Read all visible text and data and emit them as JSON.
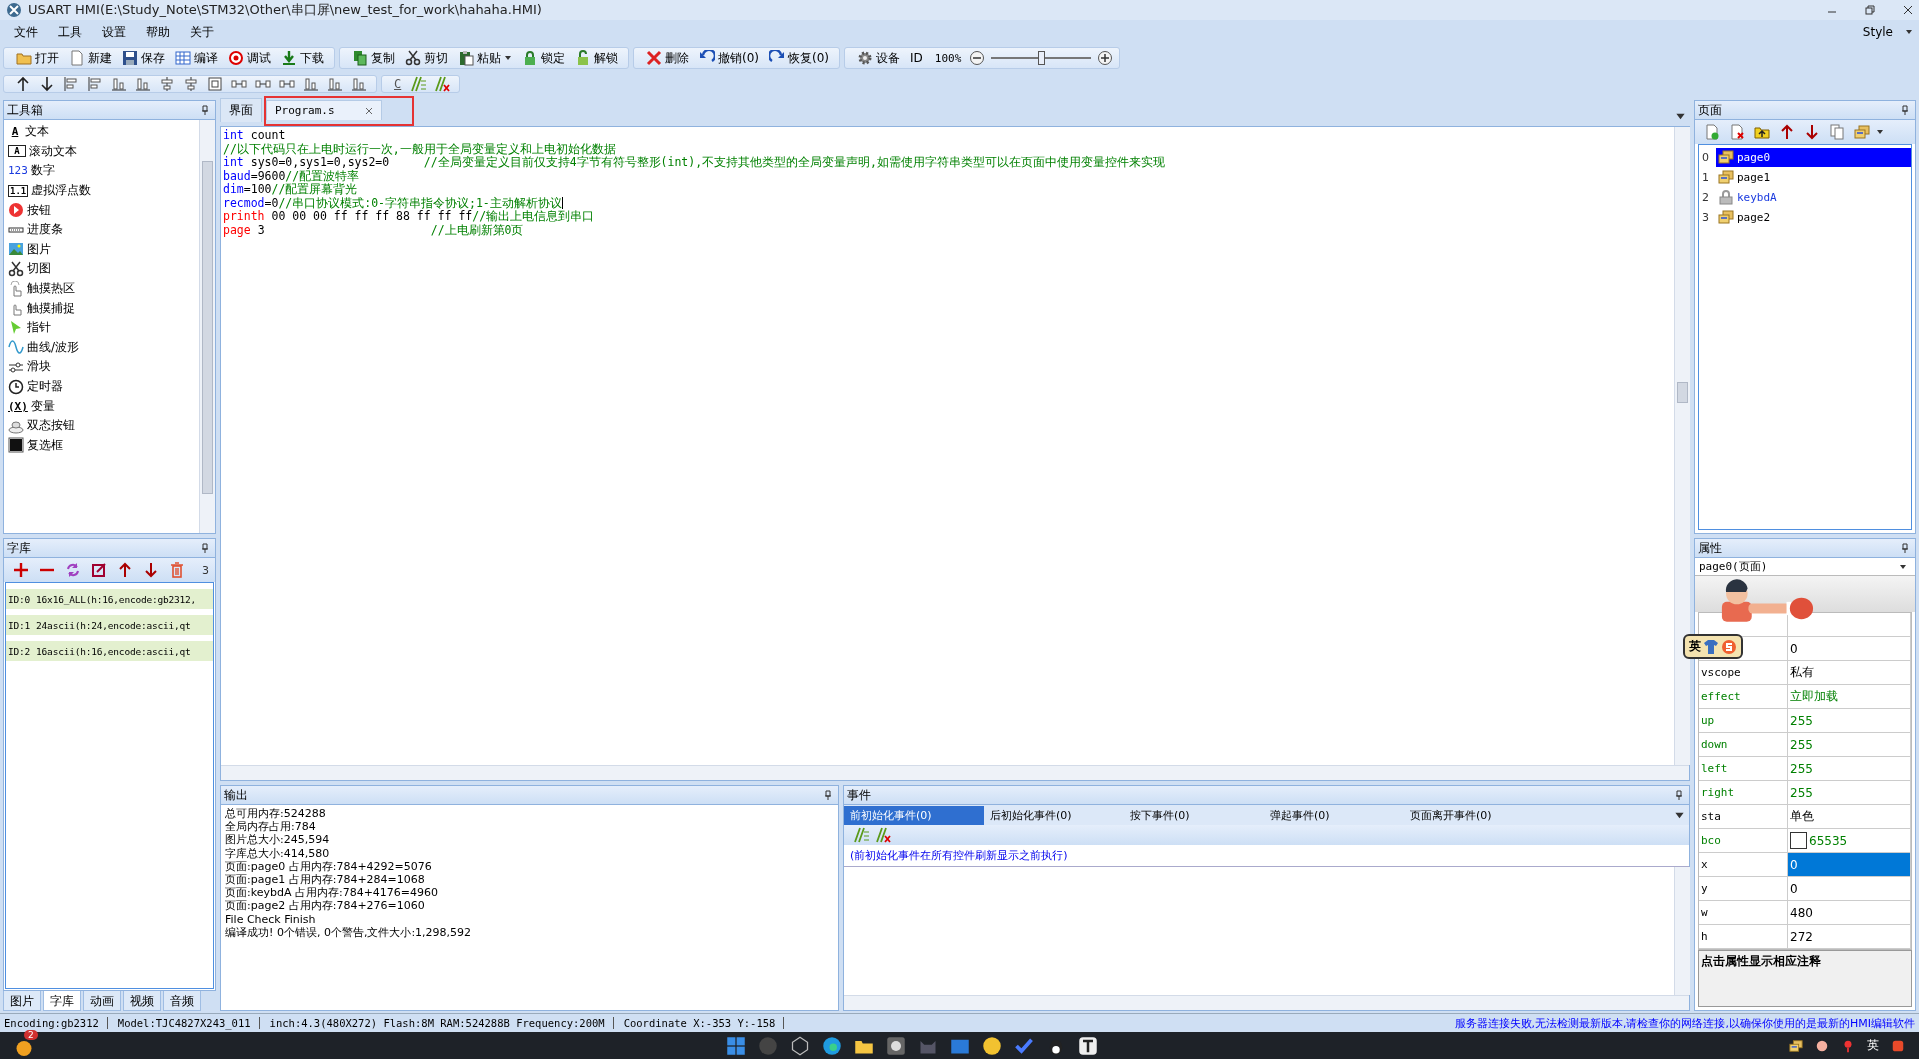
{
  "window": {
    "title": "USART  HMI(E:\\Study_Note\\STM32\\Other\\串口屏\\new_test_for_work\\hahaha.HMI)",
    "style_menu": "Style"
  },
  "menu": [
    "文件",
    "工具",
    "设置",
    "帮助",
    "关于"
  ],
  "toolbar": {
    "groups": [
      [
        "打开",
        "新建",
        "保存",
        "编译",
        "调试",
        "下载"
      ],
      [
        "复制",
        "剪切",
        "粘贴",
        "锁定",
        "解锁"
      ],
      [
        "删除",
        "撤销(0)",
        "恢复(0)"
      ]
    ],
    "device": "设备",
    "id_button": "ID",
    "zoom": {
      "reading": "100%",
      "level": 0.5
    }
  },
  "align_toolbar": {
    "code_button": "C"
  },
  "toolbox": {
    "title": "工具箱",
    "items": [
      {
        "label": "文本",
        "glyph": "A"
      },
      {
        "label": "滚动文本",
        "glyph": "A",
        "boxed": true
      },
      {
        "label": "数字",
        "glyph": "123"
      },
      {
        "label": "虚拟浮点数",
        "glyph": "1.1",
        "boxed": true
      },
      {
        "label": "按钮"
      },
      {
        "label": "进度条"
      },
      {
        "label": "图片"
      },
      {
        "label": "切图"
      },
      {
        "label": "触摸热区"
      },
      {
        "label": "触摸捕捉"
      },
      {
        "label": "指针"
      },
      {
        "label": "曲线/波形"
      },
      {
        "label": "滑块"
      },
      {
        "label": "定时器"
      },
      {
        "label": "变量",
        "glyph": "(X)"
      },
      {
        "label": "双态按钮"
      },
      {
        "label": "复选框"
      }
    ]
  },
  "font_library": {
    "title": "字库",
    "count": "3",
    "items": [
      {
        "id": "ID:0",
        "name": "16x16_ALL(h:16,encode:gb2312,"
      },
      {
        "id": "ID:1",
        "name": "24ascii(h:24,encode:ascii,qt"
      },
      {
        "id": "ID:2",
        "name": "16ascii(h:16,encode:ascii,qt"
      }
    ]
  },
  "left_tabs": [
    {
      "label": "图片",
      "selected": false
    },
    {
      "label": "字库",
      "selected": true
    },
    {
      "label": "动画",
      "selected": false
    },
    {
      "label": "视频",
      "selected": false
    },
    {
      "label": "音频",
      "selected": false
    }
  ],
  "editor_tabs": [
    {
      "label": "界面",
      "selected": false
    },
    {
      "label": "Program.s",
      "selected": true,
      "closable": true,
      "highlighted": true
    }
  ],
  "code": [
    {
      "segments": [
        {
          "text": "int",
          "kind": "keyword"
        },
        {
          "text": " count",
          "kind": "plain"
        }
      ]
    },
    {
      "segments": [
        {
          "text": "//以下代码只在上电时运行一次,一般用于全局变量定义和上电初始化数据",
          "kind": "comment"
        }
      ]
    },
    {
      "segments": [
        {
          "text": "int",
          "kind": "keyword"
        },
        {
          "text": " sys0=0,sys1=0,sys2=0     ",
          "kind": "plain"
        },
        {
          "text": "//全局变量定义目前仅支持4字节有符号整形(int),不支持其他类型的全局变量声明,如需使用字符串类型可以在页面中使用变量控件来实现",
          "kind": "comment"
        }
      ]
    },
    {
      "segments": [
        {
          "text": "baud",
          "kind": "keyword"
        },
        {
          "text": "=9600",
          "kind": "plain"
        },
        {
          "text": "//配置波特率",
          "kind": "comment"
        }
      ]
    },
    {
      "segments": [
        {
          "text": "dim",
          "kind": "keyword"
        },
        {
          "text": "=100",
          "kind": "plain"
        },
        {
          "text": "//配置屏幕背光",
          "kind": "comment"
        }
      ]
    },
    {
      "segments": [
        {
          "text": "recmod",
          "kind": "keyword"
        },
        {
          "text": "=0",
          "kind": "plain"
        },
        {
          "text": "//串口协议模式:0-字符串指令协议;1-主动解析协议",
          "kind": "comment"
        }
      ],
      "cursor": true
    },
    {
      "segments": [
        {
          "text": "printh",
          "kind": "command"
        },
        {
          "text": " 00 00 00 ff ff ff 88 ff ff ff",
          "kind": "plain"
        },
        {
          "text": "//输出上电信息到串口",
          "kind": "comment"
        }
      ]
    },
    {
      "segments": [
        {
          "text": "page",
          "kind": "command"
        },
        {
          "text": " 3                        ",
          "kind": "plain"
        },
        {
          "text": "//上电刷新第0页",
          "kind": "comment"
        }
      ]
    }
  ],
  "output": {
    "title": "输出",
    "lines": [
      "总可用内存:524288",
      "全局内存占用:784",
      "图片总大小:245,594",
      "字库总大小:414,580",
      "页面:page0 占用内存:784+4292=5076",
      "页面:page1 占用内存:784+284=1068",
      "页面:keybdA 占用内存:784+4176=4960",
      "页面:page2 占用内存:784+276=1060",
      "File Check Finish",
      "编译成功! 0个错误, 0个警告,文件大小:1,298,592"
    ]
  },
  "events": {
    "title": "事件",
    "tabs": [
      {
        "label": "前初始化事件(0)",
        "selected": true
      },
      {
        "label": "后初始化事件(0)",
        "selected": false
      },
      {
        "label": "按下事件(0)",
        "selected": false
      },
      {
        "label": "弹起事件(0)",
        "selected": false
      },
      {
        "label": "页面离开事件(0)",
        "selected": false
      }
    ],
    "note": "(前初始化事件在所有控件刷新显示之前执行)"
  },
  "pages": {
    "title": "页面",
    "items": [
      {
        "index": "0",
        "name": "page0",
        "selected": true,
        "locked": false
      },
      {
        "index": "1",
        "name": "page1",
        "selected": false,
        "locked": false
      },
      {
        "index": "2",
        "name": "keybdA",
        "selected": false,
        "locked": true
      },
      {
        "index": "3",
        "name": "page2",
        "selected": false,
        "locked": false
      }
    ]
  },
  "properties": {
    "title": "属性",
    "object": "page0(页面)",
    "rows": [
      {
        "value": "0",
        "runtime_editable": false,
        "selected": false
      },
      {
        "name": "vscope",
        "value": "私有",
        "runtime_editable": false,
        "selected": false
      },
      {
        "name": "effect",
        "value": "立即加载",
        "runtime_editable": true,
        "selected": false
      },
      {
        "name": "up",
        "value": "255",
        "runtime_editable": true,
        "selected": false
      },
      {
        "name": "down",
        "value": "255",
        "runtime_editable": true,
        "selected": false
      },
      {
        "name": "left",
        "value": "255",
        "runtime_editable": true,
        "selected": false
      },
      {
        "name": "right",
        "value": "255",
        "runtime_editable": true,
        "selected": false
      },
      {
        "name": "sta",
        "value": "单色",
        "runtime_editable": false,
        "selected": false
      },
      {
        "name": "bco",
        "value": "65535",
        "runtime_editable": true,
        "selected": false,
        "color": "#ffffff"
      },
      {
        "name": "x",
        "value": "0",
        "runtime_editable": false,
        "selected": true
      },
      {
        "name": "y",
        "value": "0",
        "runtime_editable": false,
        "selected": false
      },
      {
        "name": "w",
        "value": "480",
        "runtime_editable": false,
        "selected": false
      },
      {
        "name": "h",
        "value": "272",
        "runtime_editable": false,
        "selected": false
      }
    ],
    "hint": "点击属性显示相应注释"
  },
  "ime_status": {
    "language": "英"
  },
  "status_bar": {
    "fields": [
      "Encoding:gb2312",
      "Model:TJC4827X243_011",
      "inch:4.3(480X272) Flash:8M RAM:524288B Frequency:200M",
      "Coordinate X:-353  Y:-158"
    ],
    "message": "服务器连接失败,无法检测最新版本,请检查你的网络连接,以确保你使用的是最新的HMI编辑软件"
  },
  "taskbar": {
    "badge": "2",
    "tray_language": "英"
  }
}
